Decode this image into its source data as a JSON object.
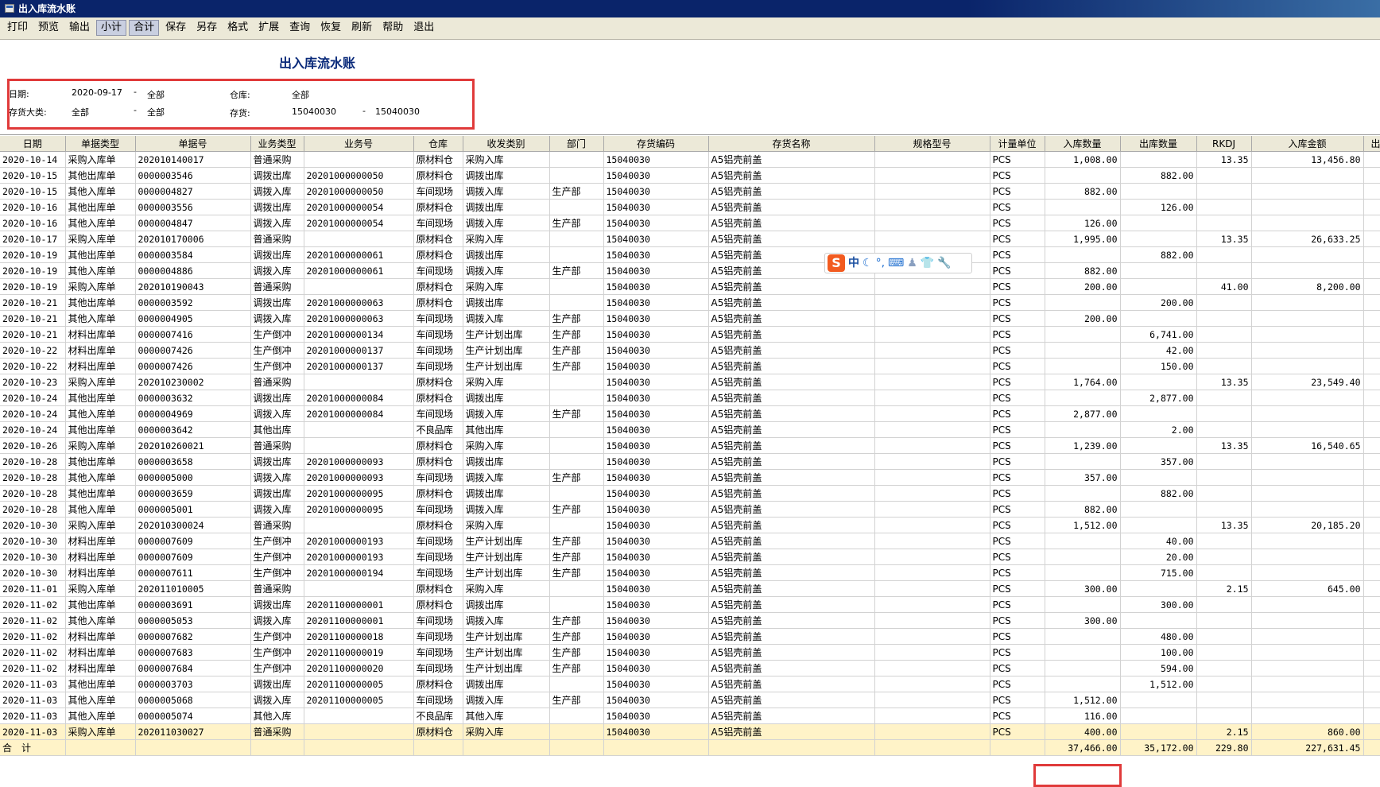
{
  "window": {
    "title": "出入库流水账"
  },
  "toolbar": [
    {
      "label": "打印",
      "active": false
    },
    {
      "label": "预览",
      "active": false
    },
    {
      "label": "输出",
      "active": false
    },
    {
      "label": "小计",
      "active": true
    },
    {
      "label": "合计",
      "active": true
    },
    {
      "label": "保存",
      "active": false
    },
    {
      "label": "另存",
      "active": false
    },
    {
      "label": "格式",
      "active": false
    },
    {
      "label": "扩展",
      "active": false
    },
    {
      "label": "查询",
      "active": false
    },
    {
      "label": "恢复",
      "active": false
    },
    {
      "label": "刷新",
      "active": false
    },
    {
      "label": "帮助",
      "active": false
    },
    {
      "label": "退出",
      "active": false
    }
  ],
  "report": {
    "title": "出入库流水账",
    "filters": {
      "date_label": "日期:",
      "date_from": "2020-09-17",
      "date_sep": "-",
      "date_to": "全部",
      "warehouse_label": "仓库:",
      "warehouse_value": "全部",
      "category_label": "存货大类:",
      "category_from": "全部",
      "category_sep": "-",
      "category_to": "全部",
      "inventory_label": "存货:",
      "inventory_from": "15040030",
      "inventory_sep": "-",
      "inventory_to": "15040030"
    }
  },
  "grid": {
    "columns": [
      "日期",
      "单据类型",
      "单据号",
      "业务类型",
      "业务号",
      "仓库",
      "收发类别",
      "部门",
      "存货编码",
      "存货名称",
      "规格型号",
      "计量单位",
      "入库数量",
      "出库数量",
      "RKDJ",
      "入库金额",
      "出库金"
    ],
    "rows": [
      [
        "2020-10-14",
        "采购入库单",
        "202010140017",
        "普通采购",
        "",
        "原材料仓",
        "采购入库",
        "",
        "15040030",
        "A5铝壳前盖",
        "",
        "PCS",
        "1,008.00",
        "",
        "13.35",
        "13,456.80",
        ""
      ],
      [
        "2020-10-15",
        "其他出库单",
        "0000003546",
        "调拨出库",
        "20201000000050",
        "原材料仓",
        "调拨出库",
        "",
        "15040030",
        "A5铝壳前盖",
        "",
        "PCS",
        "",
        "882.00",
        "",
        "",
        ""
      ],
      [
        "2020-10-15",
        "其他入库单",
        "0000004827",
        "调拨入库",
        "20201000000050",
        "车间现场",
        "调拨入库",
        "生产部",
        "15040030",
        "A5铝壳前盖",
        "",
        "PCS",
        "882.00",
        "",
        "",
        "",
        ""
      ],
      [
        "2020-10-16",
        "其他出库单",
        "0000003556",
        "调拨出库",
        "20201000000054",
        "原材料仓",
        "调拨出库",
        "",
        "15040030",
        "A5铝壳前盖",
        "",
        "PCS",
        "",
        "126.00",
        "",
        "",
        ""
      ],
      [
        "2020-10-16",
        "其他入库单",
        "0000004847",
        "调拨入库",
        "20201000000054",
        "车间现场",
        "调拨入库",
        "生产部",
        "15040030",
        "A5铝壳前盖",
        "",
        "PCS",
        "126.00",
        "",
        "",
        "",
        ""
      ],
      [
        "2020-10-17",
        "采购入库单",
        "202010170006",
        "普通采购",
        "",
        "原材料仓",
        "采购入库",
        "",
        "15040030",
        "A5铝壳前盖",
        "",
        "PCS",
        "1,995.00",
        "",
        "13.35",
        "26,633.25",
        ""
      ],
      [
        "2020-10-19",
        "其他出库单",
        "0000003584",
        "调拨出库",
        "20201000000061",
        "原材料仓",
        "调拨出库",
        "",
        "15040030",
        "A5铝壳前盖",
        "",
        "PCS",
        "",
        "882.00",
        "",
        "",
        ""
      ],
      [
        "2020-10-19",
        "其他入库单",
        "0000004886",
        "调拨入库",
        "20201000000061",
        "车间现场",
        "调拨入库",
        "生产部",
        "15040030",
        "A5铝壳前盖",
        "",
        "PCS",
        "882.00",
        "",
        "",
        "",
        ""
      ],
      [
        "2020-10-19",
        "采购入库单",
        "202010190043",
        "普通采购",
        "",
        "原材料仓",
        "采购入库",
        "",
        "15040030",
        "A5铝壳前盖",
        "",
        "PCS",
        "200.00",
        "",
        "41.00",
        "8,200.00",
        ""
      ],
      [
        "2020-10-21",
        "其他出库单",
        "0000003592",
        "调拨出库",
        "20201000000063",
        "原材料仓",
        "调拨出库",
        "",
        "15040030",
        "A5铝壳前盖",
        "",
        "PCS",
        "",
        "200.00",
        "",
        "",
        ""
      ],
      [
        "2020-10-21",
        "其他入库单",
        "0000004905",
        "调拨入库",
        "20201000000063",
        "车间现场",
        "调拨入库",
        "生产部",
        "15040030",
        "A5铝壳前盖",
        "",
        "PCS",
        "200.00",
        "",
        "",
        "",
        ""
      ],
      [
        "2020-10-21",
        "材料出库单",
        "0000007416",
        "生产倒冲",
        "20201000000134",
        "车间现场",
        "生产计划出库",
        "生产部",
        "15040030",
        "A5铝壳前盖",
        "",
        "PCS",
        "",
        "6,741.00",
        "",
        "",
        ""
      ],
      [
        "2020-10-22",
        "材料出库单",
        "0000007426",
        "生产倒冲",
        "20201000000137",
        "车间现场",
        "生产计划出库",
        "生产部",
        "15040030",
        "A5铝壳前盖",
        "",
        "PCS",
        "",
        "42.00",
        "",
        "",
        ""
      ],
      [
        "2020-10-22",
        "材料出库单",
        "0000007426",
        "生产倒冲",
        "20201000000137",
        "车间现场",
        "生产计划出库",
        "生产部",
        "15040030",
        "A5铝壳前盖",
        "",
        "PCS",
        "",
        "150.00",
        "",
        "",
        ""
      ],
      [
        "2020-10-23",
        "采购入库单",
        "202010230002",
        "普通采购",
        "",
        "原材料仓",
        "采购入库",
        "",
        "15040030",
        "A5铝壳前盖",
        "",
        "PCS",
        "1,764.00",
        "",
        "13.35",
        "23,549.40",
        ""
      ],
      [
        "2020-10-24",
        "其他出库单",
        "0000003632",
        "调拨出库",
        "20201000000084",
        "原材料仓",
        "调拨出库",
        "",
        "15040030",
        "A5铝壳前盖",
        "",
        "PCS",
        "",
        "2,877.00",
        "",
        "",
        ""
      ],
      [
        "2020-10-24",
        "其他入库单",
        "0000004969",
        "调拨入库",
        "20201000000084",
        "车间现场",
        "调拨入库",
        "生产部",
        "15040030",
        "A5铝壳前盖",
        "",
        "PCS",
        "2,877.00",
        "",
        "",
        "",
        ""
      ],
      [
        "2020-10-24",
        "其他出库单",
        "0000003642",
        "其他出库",
        "",
        "不良品库",
        "其他出库",
        "",
        "15040030",
        "A5铝壳前盖",
        "",
        "PCS",
        "",
        "2.00",
        "",
        "",
        ""
      ],
      [
        "2020-10-26",
        "采购入库单",
        "202010260021",
        "普通采购",
        "",
        "原材料仓",
        "采购入库",
        "",
        "15040030",
        "A5铝壳前盖",
        "",
        "PCS",
        "1,239.00",
        "",
        "13.35",
        "16,540.65",
        ""
      ],
      [
        "2020-10-28",
        "其他出库单",
        "0000003658",
        "调拨出库",
        "20201000000093",
        "原材料仓",
        "调拨出库",
        "",
        "15040030",
        "A5铝壳前盖",
        "",
        "PCS",
        "",
        "357.00",
        "",
        "",
        ""
      ],
      [
        "2020-10-28",
        "其他入库单",
        "0000005000",
        "调拨入库",
        "20201000000093",
        "车间现场",
        "调拨入库",
        "生产部",
        "15040030",
        "A5铝壳前盖",
        "",
        "PCS",
        "357.00",
        "",
        "",
        "",
        ""
      ],
      [
        "2020-10-28",
        "其他出库单",
        "0000003659",
        "调拨出库",
        "20201000000095",
        "原材料仓",
        "调拨出库",
        "",
        "15040030",
        "A5铝壳前盖",
        "",
        "PCS",
        "",
        "882.00",
        "",
        "",
        ""
      ],
      [
        "2020-10-28",
        "其他入库单",
        "0000005001",
        "调拨入库",
        "20201000000095",
        "车间现场",
        "调拨入库",
        "生产部",
        "15040030",
        "A5铝壳前盖",
        "",
        "PCS",
        "882.00",
        "",
        "",
        "",
        ""
      ],
      [
        "2020-10-30",
        "采购入库单",
        "202010300024",
        "普通采购",
        "",
        "原材料仓",
        "采购入库",
        "",
        "15040030",
        "A5铝壳前盖",
        "",
        "PCS",
        "1,512.00",
        "",
        "13.35",
        "20,185.20",
        ""
      ],
      [
        "2020-10-30",
        "材料出库单",
        "0000007609",
        "生产倒冲",
        "20201000000193",
        "车间现场",
        "生产计划出库",
        "生产部",
        "15040030",
        "A5铝壳前盖",
        "",
        "PCS",
        "",
        "40.00",
        "",
        "",
        ""
      ],
      [
        "2020-10-30",
        "材料出库单",
        "0000007609",
        "生产倒冲",
        "20201000000193",
        "车间现场",
        "生产计划出库",
        "生产部",
        "15040030",
        "A5铝壳前盖",
        "",
        "PCS",
        "",
        "20.00",
        "",
        "",
        ""
      ],
      [
        "2020-10-30",
        "材料出库单",
        "0000007611",
        "生产倒冲",
        "20201000000194",
        "车间现场",
        "生产计划出库",
        "生产部",
        "15040030",
        "A5铝壳前盖",
        "",
        "PCS",
        "",
        "715.00",
        "",
        "",
        ""
      ],
      [
        "2020-11-01",
        "采购入库单",
        "202011010005",
        "普通采购",
        "",
        "原材料仓",
        "采购入库",
        "",
        "15040030",
        "A5铝壳前盖",
        "",
        "PCS",
        "300.00",
        "",
        "2.15",
        "645.00",
        ""
      ],
      [
        "2020-11-02",
        "其他出库单",
        "0000003691",
        "调拨出库",
        "20201100000001",
        "原材料仓",
        "调拨出库",
        "",
        "15040030",
        "A5铝壳前盖",
        "",
        "PCS",
        "",
        "300.00",
        "",
        "",
        ""
      ],
      [
        "2020-11-02",
        "其他入库单",
        "0000005053",
        "调拨入库",
        "20201100000001",
        "车间现场",
        "调拨入库",
        "生产部",
        "15040030",
        "A5铝壳前盖",
        "",
        "PCS",
        "300.00",
        "",
        "",
        "",
        ""
      ],
      [
        "2020-11-02",
        "材料出库单",
        "0000007682",
        "生产倒冲",
        "20201100000018",
        "车间现场",
        "生产计划出库",
        "生产部",
        "15040030",
        "A5铝壳前盖",
        "",
        "PCS",
        "",
        "480.00",
        "",
        "",
        ""
      ],
      [
        "2020-11-02",
        "材料出库单",
        "0000007683",
        "生产倒冲",
        "20201100000019",
        "车间现场",
        "生产计划出库",
        "生产部",
        "15040030",
        "A5铝壳前盖",
        "",
        "PCS",
        "",
        "100.00",
        "",
        "",
        ""
      ],
      [
        "2020-11-02",
        "材料出库单",
        "0000007684",
        "生产倒冲",
        "20201100000020",
        "车间现场",
        "生产计划出库",
        "生产部",
        "15040030",
        "A5铝壳前盖",
        "",
        "PCS",
        "",
        "594.00",
        "",
        "",
        ""
      ],
      [
        "2020-11-03",
        "其他出库单",
        "0000003703",
        "调拨出库",
        "20201100000005",
        "原材料仓",
        "调拨出库",
        "",
        "15040030",
        "A5铝壳前盖",
        "",
        "PCS",
        "",
        "1,512.00",
        "",
        "",
        ""
      ],
      [
        "2020-11-03",
        "其他入库单",
        "0000005068",
        "调拨入库",
        "20201100000005",
        "车间现场",
        "调拨入库",
        "生产部",
        "15040030",
        "A5铝壳前盖",
        "",
        "PCS",
        "1,512.00",
        "",
        "",
        "",
        ""
      ],
      [
        "2020-11-03",
        "其他入库单",
        "0000005074",
        "其他入库",
        "",
        "不良品库",
        "其他入库",
        "",
        "15040030",
        "A5铝壳前盖",
        "",
        "PCS",
        "116.00",
        "",
        "",
        "",
        ""
      ],
      [
        "2020-11-03",
        "采购入库单",
        "202011030027",
        "普通采购",
        "",
        "原材料仓",
        "采购入库",
        "",
        "15040030",
        "A5铝壳前盖",
        "",
        "PCS",
        "400.00",
        "",
        "2.15",
        "860.00",
        ""
      ]
    ],
    "total_row": [
      "合　计",
      "",
      "",
      "",
      "",
      "",
      "",
      "",
      "",
      "",
      "",
      "",
      "37,466.00",
      "35,172.00",
      "229.80",
      "227,631.45",
      ""
    ]
  },
  "ime": {
    "logo": "S",
    "mode": "中"
  }
}
